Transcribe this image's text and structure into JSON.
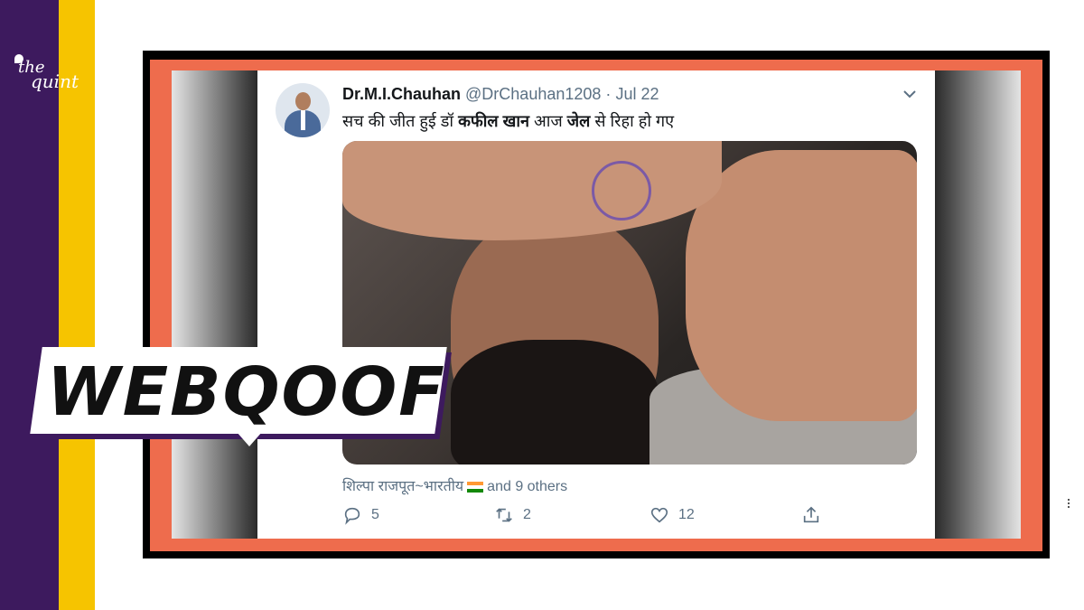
{
  "brand": {
    "logo_line1": "the",
    "logo_line2": "quint",
    "colors": {
      "purple": "#3d1a5e",
      "yellow": "#f6c400",
      "frame_orange": "#ee6c4d"
    }
  },
  "badge": {
    "label": "WEBQOOF"
  },
  "tweet": {
    "name": "Dr.M.I.Chauhan",
    "handle": "@DrChauhan1208",
    "separator": "·",
    "date": "Jul 22",
    "text_part1": "सच की जीत हुई डॉ ",
    "text_bold1": "कफील खान",
    "text_part2": " आज ",
    "text_bold2": "जेल",
    "text_part3": " से रिहा हो गए",
    "likers_name": "शिल्पा राजपूत~भारतीय",
    "likers_rest": "and 9 others",
    "actions": {
      "reply_count": "5",
      "retweet_count": "2",
      "like_count": "12"
    },
    "icons": {
      "more": "chevron-down-icon",
      "reply": "reply-icon",
      "retweet": "retweet-icon",
      "like": "heart-icon",
      "share": "share-icon"
    }
  }
}
